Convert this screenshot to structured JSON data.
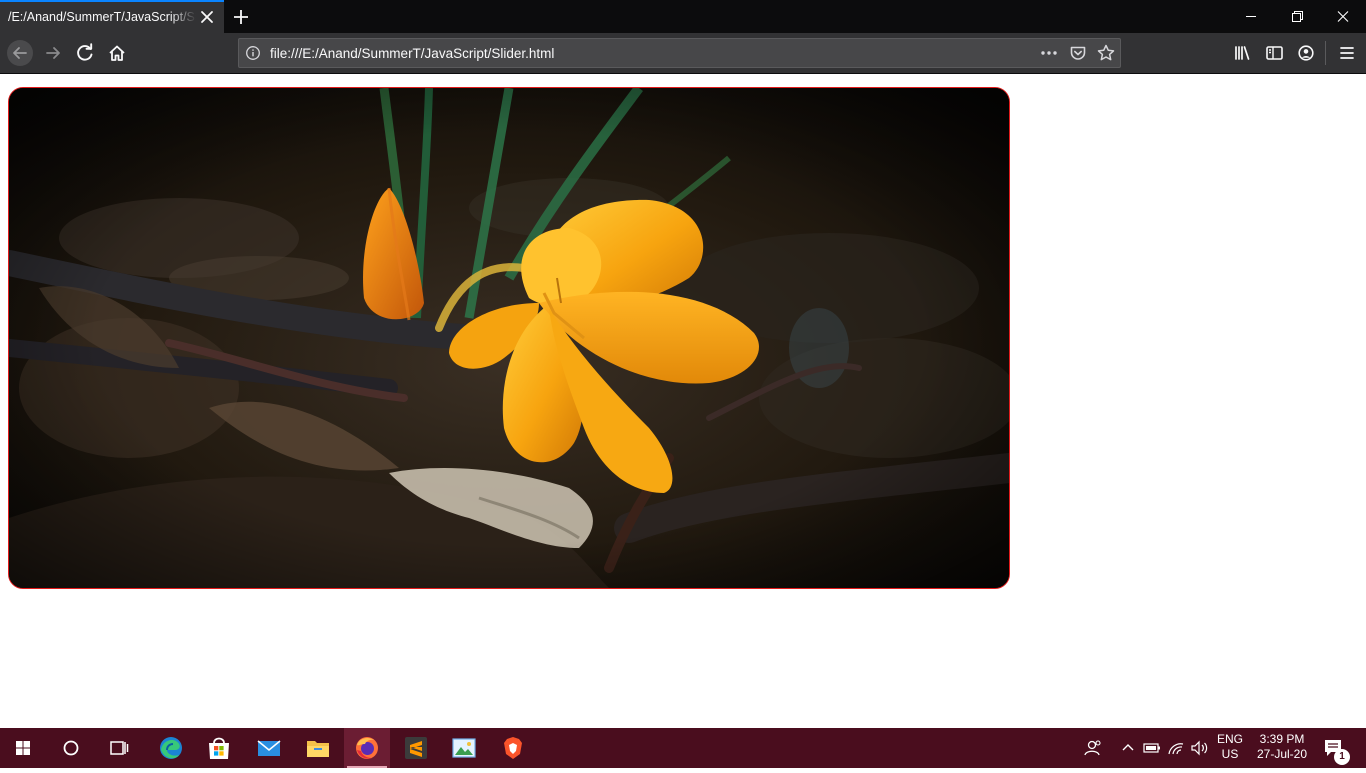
{
  "browser": {
    "tab": {
      "title": "/E:/Anand/SummerT/JavaScript/Slider.html",
      "close_icon": "close-icon"
    },
    "new_tab_icon": "plus-icon",
    "window_controls": [
      "minimize-icon",
      "restore-icon",
      "close-icon"
    ],
    "nav": {
      "back_icon": "arrow-left-icon",
      "forward_icon": "arrow-right-icon",
      "reload_icon": "reload-icon",
      "home_icon": "home-icon"
    },
    "url": "file:///E:/Anand/SummerT/JavaScript/Slider.html",
    "url_actions": [
      "more-actions-icon",
      "pocket-icon",
      "bookmark-star-icon"
    ],
    "toolbar_right": [
      "library-icon",
      "sidebar-icon",
      "account-icon",
      "menu-icon"
    ],
    "colors": {
      "tab_accent": "#0a84ff",
      "toolbar": "#323234",
      "tabstrip": "#0c0c0d"
    }
  },
  "page": {
    "slider": {
      "image": "yellow-crocus-flower-photo",
      "border_color": "#e21b1b"
    }
  },
  "taskbar": {
    "background": "#4a0d1e",
    "apps": [
      "start-icon",
      "search-circle-icon",
      "task-view-icon",
      "edge-icon",
      "store-icon",
      "mail-icon",
      "file-explorer-icon",
      "firefox-icon",
      "sublime-text-icon",
      "photos-icon",
      "brave-icon"
    ],
    "tray_icons": [
      "people-icon",
      "chevron-up-icon",
      "battery-icon",
      "wifi-icon",
      "volume-icon"
    ],
    "language": {
      "line1": "ENG",
      "line2": "US"
    },
    "clock": {
      "time": "3:39 PM",
      "date": "27-Jul-20"
    },
    "notification_count": "1"
  }
}
